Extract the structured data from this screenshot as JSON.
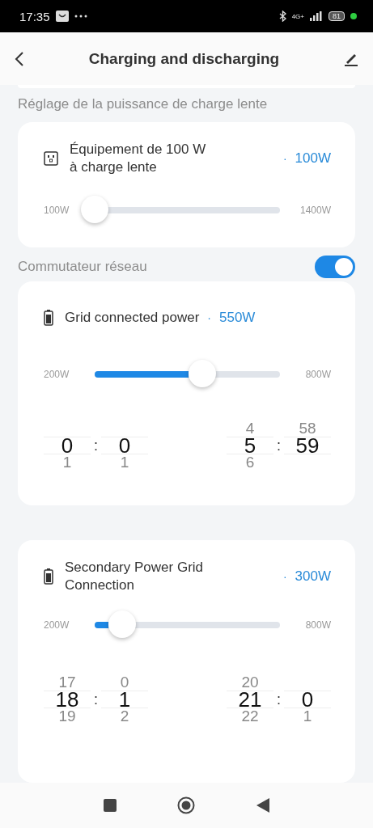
{
  "status_bar": {
    "time": "17:35",
    "network": "4G+",
    "battery": "81"
  },
  "header": {
    "title": "Charging and discharging"
  },
  "section_label": "Réglage de la puissance de charge lente",
  "slow_card": {
    "title": "Équipement de 100 W à charge lente",
    "dot": "·",
    "value": "100W",
    "slider": {
      "min": "100W",
      "max": "1400W",
      "level": 0
    }
  },
  "grid_switch": {
    "label": "Commutateur réseau",
    "on": true
  },
  "cards": [
    {
      "title": "Grid connected power",
      "dot": "·",
      "value": "550W",
      "slider": {
        "min": "200W",
        "max": "800W",
        "level": 0.58
      },
      "times": [
        {
          "hour": {
            "value": "0",
            "below": "1"
          },
          "separator": ":",
          "minute": {
            "value": "0",
            "below": "1"
          }
        },
        {
          "hour": {
            "above": "4",
            "value": "5",
            "below": "6"
          },
          "separator": ":",
          "minute": {
            "above": "58",
            "value": "59"
          }
        }
      ]
    },
    {
      "title": "Secondary Power Grid Connection",
      "dot": "·",
      "value": "300W",
      "slider": {
        "min": "200W",
        "max": "800W",
        "level": 0.15
      },
      "times": [
        {
          "hour": {
            "above": "17",
            "value": "18",
            "below": "19"
          },
          "separator": ":",
          "minute": {
            "above": "0",
            "value": "1",
            "below": "2"
          }
        },
        {
          "hour": {
            "above": "20",
            "value": "21",
            "below": "22"
          },
          "separator": ":",
          "minute": {
            "value": "0",
            "below": "1"
          }
        }
      ]
    }
  ]
}
